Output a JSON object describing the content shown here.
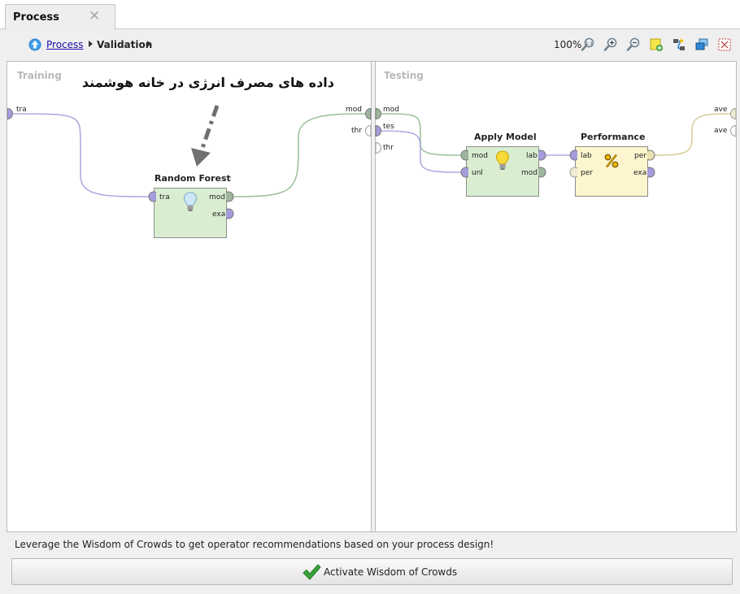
{
  "tab": {
    "title": "Process",
    "close_glyph": "✕"
  },
  "breadcrumb": {
    "up_icon": "up-arrow-icon",
    "items": [
      {
        "label": "Process"
      },
      {
        "label": "Validation"
      }
    ]
  },
  "toolbar": {
    "zoom_level": "100%",
    "buttons": [
      "zoom-reset-icon",
      "zoom-in-icon",
      "zoom-out-icon",
      "add-note-icon",
      "auto-wire-icon",
      "arrange-icon",
      "fit-view-icon"
    ]
  },
  "canvas": {
    "training": {
      "title": "Training",
      "input_ports": [
        "tra"
      ],
      "output_ports": [
        "mod",
        "thr"
      ]
    },
    "testing": {
      "title": "Testing",
      "input_ports": [
        "mod",
        "tes",
        "thr"
      ],
      "output_ports": [
        "ave",
        "ave"
      ]
    },
    "annotation": {
      "text": "داده های مصرف انرژی در خانه هوشمند"
    },
    "operators": [
      {
        "name": "Random Forest",
        "inputs": [
          "tra"
        ],
        "outputs": [
          "mod",
          "exa"
        ],
        "icon": "lightbulb-icon"
      },
      {
        "name": "Apply Model",
        "inputs": [
          "mod",
          "unl"
        ],
        "outputs": [
          "lab",
          "mod"
        ],
        "icon": "lightbulb-icon"
      },
      {
        "name": "Performance",
        "inputs": [
          "lab",
          "per"
        ],
        "outputs": [
          "per",
          "exa"
        ],
        "icon": "percent-icon"
      }
    ]
  },
  "bottom": {
    "wisdom_text": "Leverage the Wisdom of Crowds to get operator recommendations based on your process design!",
    "activate_label": "Activate Wisdom of Crowds"
  },
  "colors": {
    "port_purple": "#a49cdb",
    "port_green": "#9cb69c",
    "op_green": "#d9eed1",
    "op_yellow": "#fcf5cd",
    "wire_purple": "#b2aae0",
    "wire_green": "#9cc39c",
    "wire_tan": "#d8cf9d"
  }
}
